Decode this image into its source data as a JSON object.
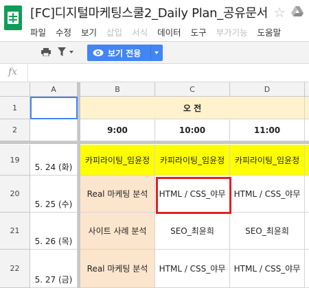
{
  "title": "[FC]디지털마케팅스쿨2_Daily Plan_공유문서",
  "menu": [
    {
      "label": "파일",
      "disabled": false
    },
    {
      "label": "수정",
      "disabled": false
    },
    {
      "label": "보기",
      "disabled": false
    },
    {
      "label": "삽입",
      "disabled": true
    },
    {
      "label": "서식",
      "disabled": true
    },
    {
      "label": "데이터",
      "disabled": false
    },
    {
      "label": "도구",
      "disabled": false
    },
    {
      "label": "부가기능",
      "disabled": true
    },
    {
      "label": "도움말",
      "disabled": false
    }
  ],
  "toolbar": {
    "view_only_label": "보기 전용",
    "accent_color": "#4285f4"
  },
  "formula_bar": {
    "fx_label": "fx",
    "value": ""
  },
  "columns": [
    "A",
    "B",
    "C",
    "D"
  ],
  "header_rows": [
    {
      "row": "1",
      "a": "",
      "merged": "오 전"
    },
    {
      "row": "2",
      "a": "",
      "b": "9:00",
      "c": "10:00",
      "d": "11:00"
    }
  ],
  "body_rows": [
    {
      "row": "19",
      "a": "5. 24 (화)",
      "b": "카피라이팅_임윤정",
      "c": "카피라이팅_임윤정",
      "d": "카피라이팅_임윤정"
    },
    {
      "row": "20",
      "a": "5. 25 (수)",
      "b": "Real 마케팅 분석",
      "c": "HTML / CSS_야무",
      "d": "HTML / CSS_야무"
    },
    {
      "row": "21",
      "a": "5. 26 (목)",
      "b": "사이트 사례 분석",
      "c": "SEO_최윤희",
      "d": "SEO_최윤희"
    },
    {
      "row": "22",
      "a": "5. 27 (금)",
      "b": "Real 마케팅 분석",
      "c": "HTML / CSS_야무",
      "d": "HTML / CSS_야무"
    }
  ],
  "colors": {
    "header_yellow": "#fff2cc",
    "highlight_yellow": "#ffff00",
    "peach": "#fce5cd",
    "annotation_red": "#e02020",
    "sheets_green": "#0f9d58"
  }
}
